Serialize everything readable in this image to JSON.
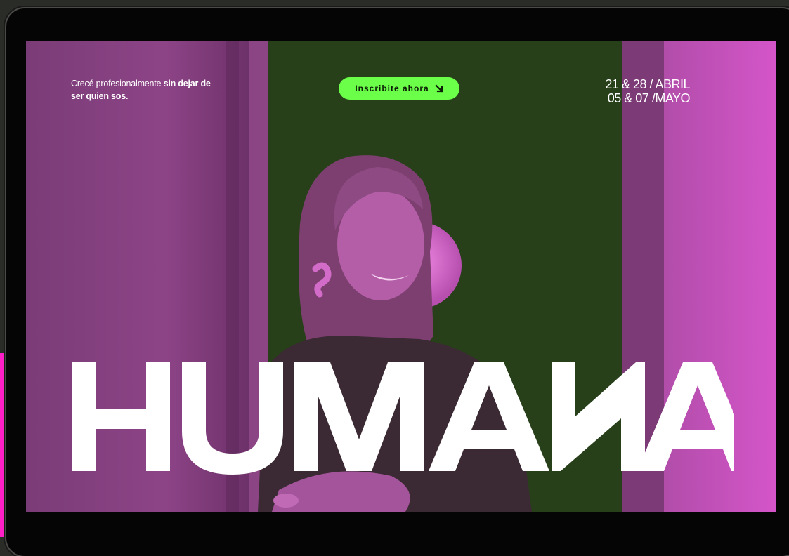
{
  "hero": {
    "tagline_regular": "Crecé profesionalmente ",
    "tagline_bold": "sin dejar de ser quien sos.",
    "cta_label": "Inscribite ahora",
    "cta_icon": "arrow-down-right-icon",
    "dates_line1": "21 & 28 / ABRIL",
    "dates_line2": "05 & 07 /MAYO",
    "brand": "HUMANA"
  },
  "colors": {
    "magenta": "#c24fbf",
    "dark_green": "#274019",
    "cta_green": "#6bff4a",
    "accent_pink": "#ff1fc6"
  }
}
